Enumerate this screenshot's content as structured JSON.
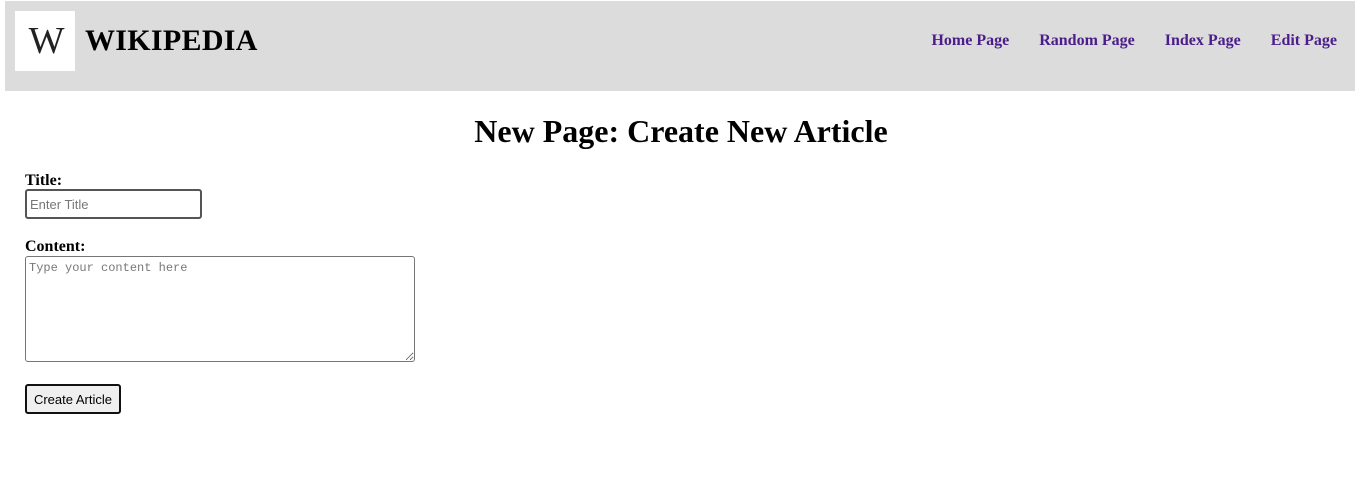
{
  "header": {
    "logo_glyph": "W",
    "logo_icon": "wikipedia-logo-icon",
    "brand": "WIKIPEDIA",
    "nav": [
      {
        "label": "Home Page"
      },
      {
        "label": "Random Page"
      },
      {
        "label": "Index Page"
      },
      {
        "label": "Edit Page"
      }
    ],
    "nav_color": "#4b1d8a",
    "background": "#dcdcdc"
  },
  "main": {
    "title": "New Page: Create New Article",
    "form": {
      "title_label": "Title:",
      "title_placeholder": "Enter Title",
      "title_value": "",
      "content_label": "Content:",
      "content_placeholder": "Type your content here",
      "content_value": "",
      "submit_label": "Create Article"
    }
  }
}
